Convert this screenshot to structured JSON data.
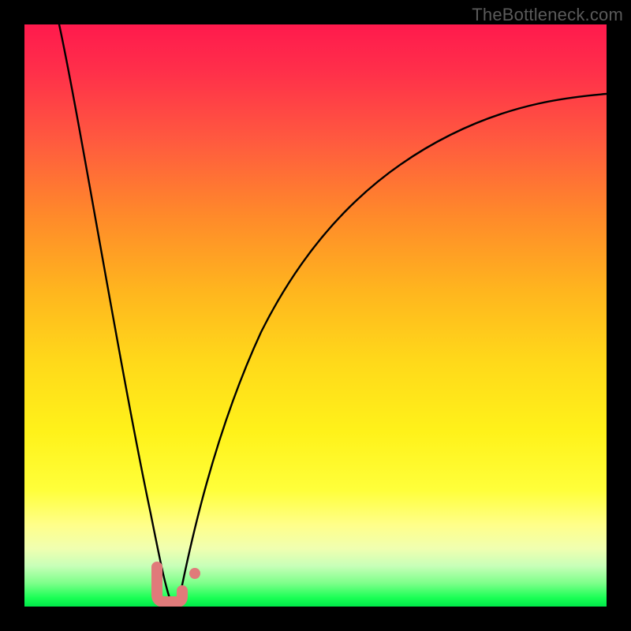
{
  "watermark": "TheBottleneck.com",
  "colors": {
    "frame": "#000000",
    "curve": "#000000",
    "marker": "#e07a7a",
    "gradient_top": "#ff1a4d",
    "gradient_bottom": "#00e84a"
  },
  "chart_data": {
    "type": "line",
    "title": "",
    "xlabel": "",
    "ylabel": "",
    "xlim": [
      0,
      100
    ],
    "ylim": [
      0,
      100
    ],
    "grid": false,
    "x": [
      0,
      2,
      4,
      6,
      8,
      10,
      12,
      14,
      16,
      18,
      20,
      22,
      24,
      25,
      26,
      28,
      30,
      32,
      35,
      40,
      45,
      50,
      55,
      60,
      65,
      70,
      75,
      80,
      85,
      90,
      95,
      100
    ],
    "series": [
      {
        "name": "left-branch",
        "x": [
          6,
          8,
          10,
          12,
          14,
          16,
          18,
          20,
          21,
          22,
          23,
          24,
          25
        ],
        "y": [
          100,
          89,
          78,
          67,
          57,
          47,
          37,
          26,
          20,
          14,
          9,
          4,
          0
        ]
      },
      {
        "name": "right-branch",
        "x": [
          25,
          26,
          28,
          30,
          32,
          35,
          40,
          45,
          50,
          55,
          60,
          65,
          70,
          75,
          80,
          85,
          90,
          95,
          100
        ],
        "y": [
          0,
          4,
          12,
          20,
          27,
          36,
          48,
          57,
          64,
          69,
          73,
          77,
          79,
          82,
          83.5,
          85,
          86,
          87,
          88
        ]
      }
    ],
    "annotations": [
      {
        "name": "valley-marker",
        "shape": "L",
        "approx_x_range": [
          22,
          26
        ],
        "approx_y_range": [
          0,
          6
        ],
        "color": "#e07a7a"
      },
      {
        "name": "right-dot",
        "shape": "dot",
        "approx_x": 28.5,
        "approx_y": 6,
        "color": "#e07a7a"
      }
    ]
  }
}
